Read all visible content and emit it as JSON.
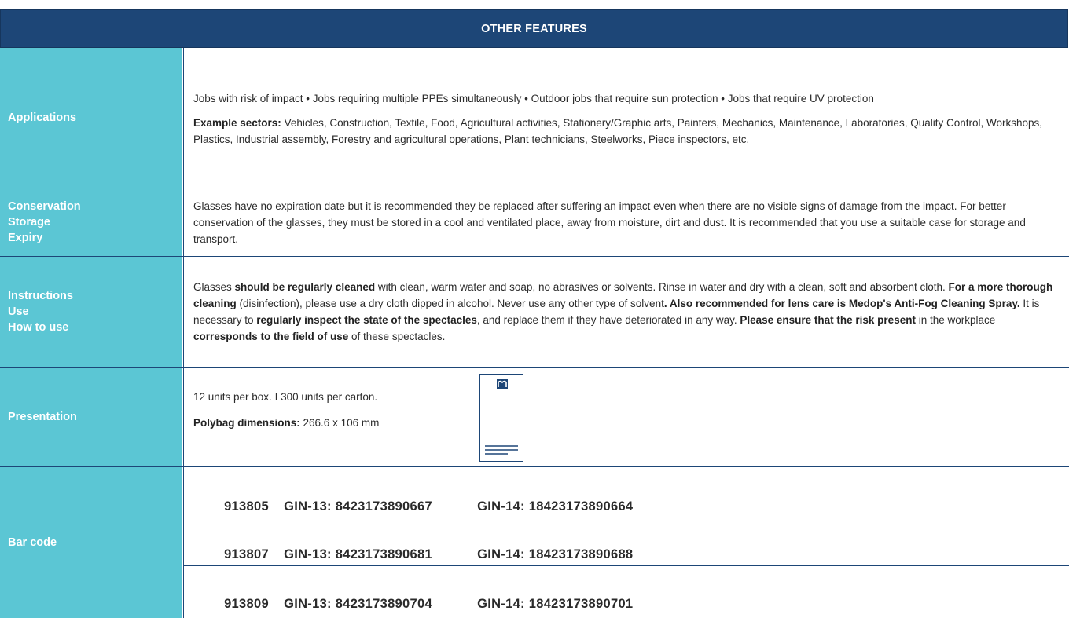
{
  "header": {
    "title": "OTHER FEATURES"
  },
  "rows": {
    "applications": {
      "label": "Applications",
      "text": "Jobs with risk of impact • Jobs requiring multiple PPEs simultaneously • Outdoor jobs that require sun protection • Jobs that require UV protection",
      "sectors_label": "Example sectors:",
      "sectors": " Vehicles, Construction, Textile, Food, Agricultural activities, Stationery/Graphic arts, Painters, Mechanics, Maintenance, Laboratories, Quality Control, Workshops, Plastics, Industrial assembly, Forestry and agricultural operations, Plant technicians, Steelworks, Piece inspectors, etc."
    },
    "conservation": {
      "label_1": "Conservation",
      "label_2": "Storage",
      "label_3": "Expiry",
      "text": "Glasses have no expiration date but it is recommended they be replaced after suffering an impact even when there are no visible signs of damage from the impact. For better conservation of the glasses, they must be stored in a cool and ventilated place, away from moisture, dirt and dust. It is recommended that you use a suitable case for storage and transport."
    },
    "instructions": {
      "label_1": "Instructions",
      "label_2": "Use",
      "label_3": "How to use",
      "t1": "Glasses ",
      "b1": "should be regularly cleaned",
      "t2": " with clean, warm water and soap, no abrasives or solvents. Rinse in water and dry with a clean, soft and absorbent cloth. ",
      "b2": "For a more thorough cleaning",
      "t3": " (disinfection), please use a dry cloth dipped in alcohol. Never use any other type of solvent",
      "b3": ". Also recommended for lens care is Medop's Anti-Fog Cleaning Spray.",
      "t4": " It is necessary to ",
      "b4": "regularly inspect the state of the spectacles",
      "t5": ", and replace them if they have deteriorated in any way. ",
      "b5": "Please ensure that the risk present",
      "t6": " in the workplace ",
      "b6": "corresponds to the field of use",
      "t7": " of these spectacles."
    },
    "presentation": {
      "label": "Presentation",
      "units": "12 units per box.  I  300 units per carton.",
      "polybag_label": "Polybag dimensions:",
      "polybag_value": " 266.6 x 106 mm"
    },
    "barcode": {
      "label": "Bar code",
      "items": [
        {
          "id": "913805",
          "gin13": "GIN-13: 8423173890667",
          "gin14": "GIN-14: 18423173890664"
        },
        {
          "id": "913807",
          "gin13": "GIN-13: 8423173890681",
          "gin14": "GIN-14: 18423173890688"
        },
        {
          "id": "913809",
          "gin13": "GIN-13: 8423173890704",
          "gin14": "GIN-14: 18423173890701"
        }
      ]
    }
  },
  "colors": {
    "header": "#1d4677",
    "label_bg": "#5bc6d4",
    "text": "#2b2b2b"
  },
  "icons": {
    "package": "box-drawing-icon",
    "logo": "medop-logo-icon"
  }
}
